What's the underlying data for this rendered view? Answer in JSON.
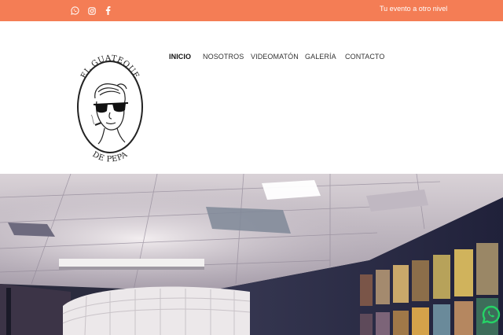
{
  "topbar": {
    "background": "#f47d55",
    "social": [
      {
        "icon": "whatsapp-icon"
      },
      {
        "icon": "instagram-icon"
      },
      {
        "icon": "facebook-icon"
      }
    ],
    "tagline": "Tu evento a otro nivel"
  },
  "header": {
    "logo": {
      "top_text": "EL GUATEQUE",
      "bottom_text": "DE PEPA"
    },
    "nav": [
      {
        "label": "INICIO",
        "active": true
      },
      {
        "label": "NOSOTROS",
        "active": false
      },
      {
        "label": "VIDEOMATÓN",
        "active": false
      },
      {
        "label": "GALERÍA",
        "active": false
      },
      {
        "label": "CONTACTO",
        "active": false
      }
    ]
  },
  "hero": {
    "image": "event-hall-photo"
  },
  "floating": {
    "icon": "whatsapp-icon",
    "color": "#25d366"
  }
}
